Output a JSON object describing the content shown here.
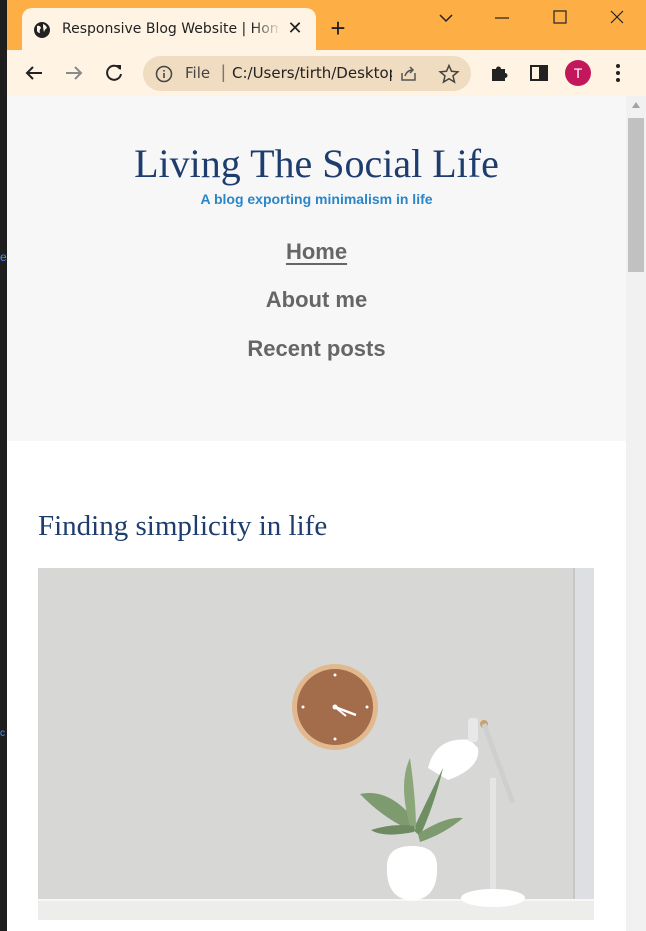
{
  "browser": {
    "tab_title": "Responsive Blog Website | Home",
    "tab_close": "✕",
    "new_tab": "+",
    "url_scheme": "File",
    "url_separator": "|",
    "url_text": "C:/Users/tirth/Desktop/Blog/index.html",
    "avatar_letter": "T",
    "accent_color": "#fdaf45",
    "avatar_color": "#c2185b"
  },
  "site": {
    "title": "Living The Social Life",
    "tagline": "A blog exporting minimalism in life",
    "nav": [
      {
        "label": "Home"
      },
      {
        "label": "About me"
      },
      {
        "label": "Recent posts"
      }
    ]
  },
  "post": {
    "title": "Finding simplicity in life",
    "image": "clock-plant-lamp-photo"
  },
  "icons": {
    "tab_favicon": "globe-icon",
    "back": "back-arrow-icon",
    "forward": "forward-arrow-icon",
    "reload": "reload-icon",
    "info": "info-icon",
    "share": "share-icon",
    "bookmark": "star-icon",
    "extensions": "puzzle-icon",
    "side_panel": "side-panel-icon",
    "menu": "kebab-menu-icon"
  }
}
